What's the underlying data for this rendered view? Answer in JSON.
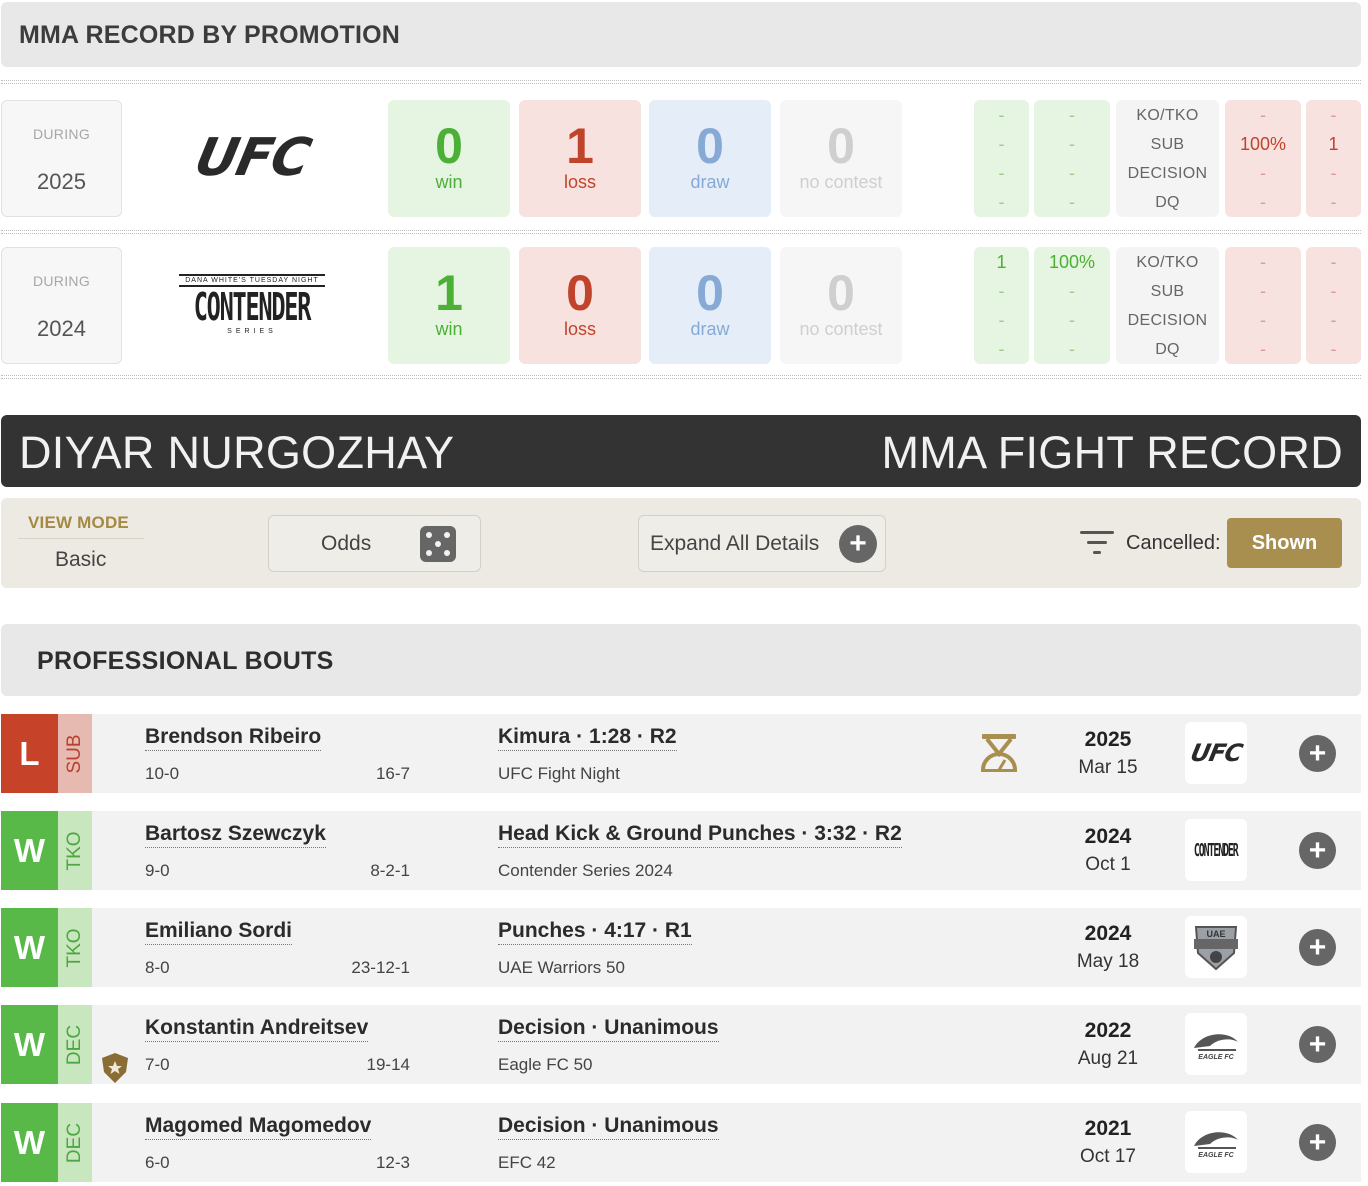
{
  "promotion_section": {
    "title": "MMA RECORD BY PROMOTION",
    "rows": [
      {
        "during_label": "DURING",
        "year": "2025",
        "promotion": "UFC",
        "win": "0",
        "win_label": "win",
        "loss": "1",
        "loss_label": "loss",
        "draw": "0",
        "draw_label": "draw",
        "nc": "0",
        "nc_label": "no contest",
        "win_count_col": [
          "-",
          "-",
          "-",
          "-"
        ],
        "win_pct_col": [
          "-",
          "-",
          "-",
          "-"
        ],
        "methods": [
          "KO/TKO",
          "SUB",
          "DECISION",
          "DQ"
        ],
        "loss_pct_col": [
          "-",
          "100%",
          "-",
          "-"
        ],
        "loss_count_col": [
          "-",
          "1",
          "-",
          "-"
        ]
      },
      {
        "during_label": "DURING",
        "year": "2024",
        "promotion": "CONTENDER",
        "promotion_small": "DANA WHITE'S TUESDAY NIGHT",
        "promotion_sub": "SERIES",
        "win": "1",
        "win_label": "win",
        "loss": "0",
        "loss_label": "loss",
        "draw": "0",
        "draw_label": "draw",
        "nc": "0",
        "nc_label": "no contest",
        "win_count_col": [
          "1",
          "-",
          "-",
          "-"
        ],
        "win_pct_col": [
          "100%",
          "-",
          "-",
          "-"
        ],
        "methods": [
          "KO/TKO",
          "SUB",
          "DECISION",
          "DQ"
        ],
        "loss_pct_col": [
          "-",
          "-",
          "-",
          "-"
        ],
        "loss_count_col": [
          "-",
          "-",
          "-",
          "-"
        ]
      }
    ]
  },
  "banner": {
    "fighter": "DIYAR NURGOZHAY",
    "title": "MMA FIGHT RECORD"
  },
  "view_bar": {
    "view_mode_label": "VIEW MODE",
    "view_mode_value": "Basic",
    "odds_label": "Odds",
    "expand_label": "Expand All Details",
    "cancelled_label": "Cancelled:",
    "shown_label": "Shown"
  },
  "bouts_section": {
    "title": "PROFESSIONAL BOUTS",
    "fights": [
      {
        "result": "L",
        "method_short": "SUB",
        "opponent": "Brendson Ribeiro",
        "fighter_record": "10-0",
        "opponent_record": "16-7",
        "method": "Kimura · 1:28 · R2",
        "event": "UFC Fight Night",
        "year": "2025",
        "date": "Mar 15",
        "promotion": "UFC",
        "weight_icon": true,
        "title_icon": false
      },
      {
        "result": "W",
        "method_short": "TKO",
        "opponent": "Bartosz Szewczyk",
        "fighter_record": "9-0",
        "opponent_record": "8-2-1",
        "method": "Head Kick & Ground Punches · 3:32 · R2",
        "event": "Contender Series 2024",
        "year": "2024",
        "date": "Oct 1",
        "promotion": "CONTENDER",
        "weight_icon": false,
        "title_icon": false
      },
      {
        "result": "W",
        "method_short": "TKO",
        "opponent": "Emiliano Sordi",
        "fighter_record": "8-0",
        "opponent_record": "23-12-1",
        "method": "Punches · 4:17 · R1",
        "event": "UAE Warriors 50",
        "year": "2024",
        "date": "May 18",
        "promotion": "UAE",
        "weight_icon": false,
        "title_icon": false
      },
      {
        "result": "W",
        "method_short": "DEC",
        "opponent": "Konstantin Andreitsev",
        "fighter_record": "7-0",
        "opponent_record": "19-14",
        "method": "Decision · Unanimous",
        "event": "Eagle FC 50",
        "year": "2022",
        "date": "Aug 21",
        "promotion": "EAGLE FC",
        "weight_icon": false,
        "title_icon": true
      },
      {
        "result": "W",
        "method_short": "DEC",
        "opponent": "Magomed Magomedov",
        "fighter_record": "6-0",
        "opponent_record": "12-3",
        "method": "Decision · Unanimous",
        "event": "EFC 42",
        "year": "2021",
        "date": "Oct 17",
        "promotion": "EAGLE FC",
        "weight_icon": false,
        "title_icon": false
      }
    ]
  },
  "colors": {
    "win": "#58b949",
    "loss": "#c6432a",
    "draw": "#87a9d6",
    "gold": "#a88f4f",
    "banner": "#333333"
  }
}
